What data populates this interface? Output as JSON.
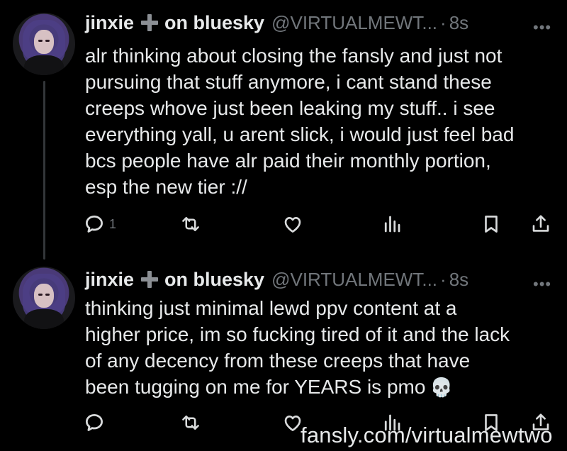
{
  "posts": [
    {
      "name": "jinxie",
      "suffix": "on bluesky",
      "handle": "@VIRTUALMEWT...",
      "time": "8s",
      "text": "alr thinking about closing the fansly and just not\npursuing that stuff anymore, i cant stand these\ncreeps whove just been leaking my stuff.. i see\neverything yall, u arent slick, i would just feel bad\nbcs people have alr paid their monthly portion,\nesp the new tier ://",
      "reply_count": "1"
    },
    {
      "name": "jinxie",
      "suffix": "on bluesky",
      "handle": "@VIRTUALMEWT...",
      "time": "8s",
      "text": "thinking just minimal lewd ppv content at a\nhigher price, im so fucking tired of it and the lack\nof any decency from these creeps that have\nbeen tugging on me for YEARS is pmo",
      "emoji": "💀"
    }
  ],
  "watermark": "fansly.com/virtualmewtwo",
  "colors": {
    "background": "#000000",
    "text": "#e7e9ea",
    "muted": "#71767b"
  },
  "icons": [
    "reply-icon",
    "repost-icon",
    "like-icon",
    "views-icon",
    "bookmark-icon",
    "share-icon",
    "more-icon",
    "plus-icon",
    "skull-emoji"
  ]
}
